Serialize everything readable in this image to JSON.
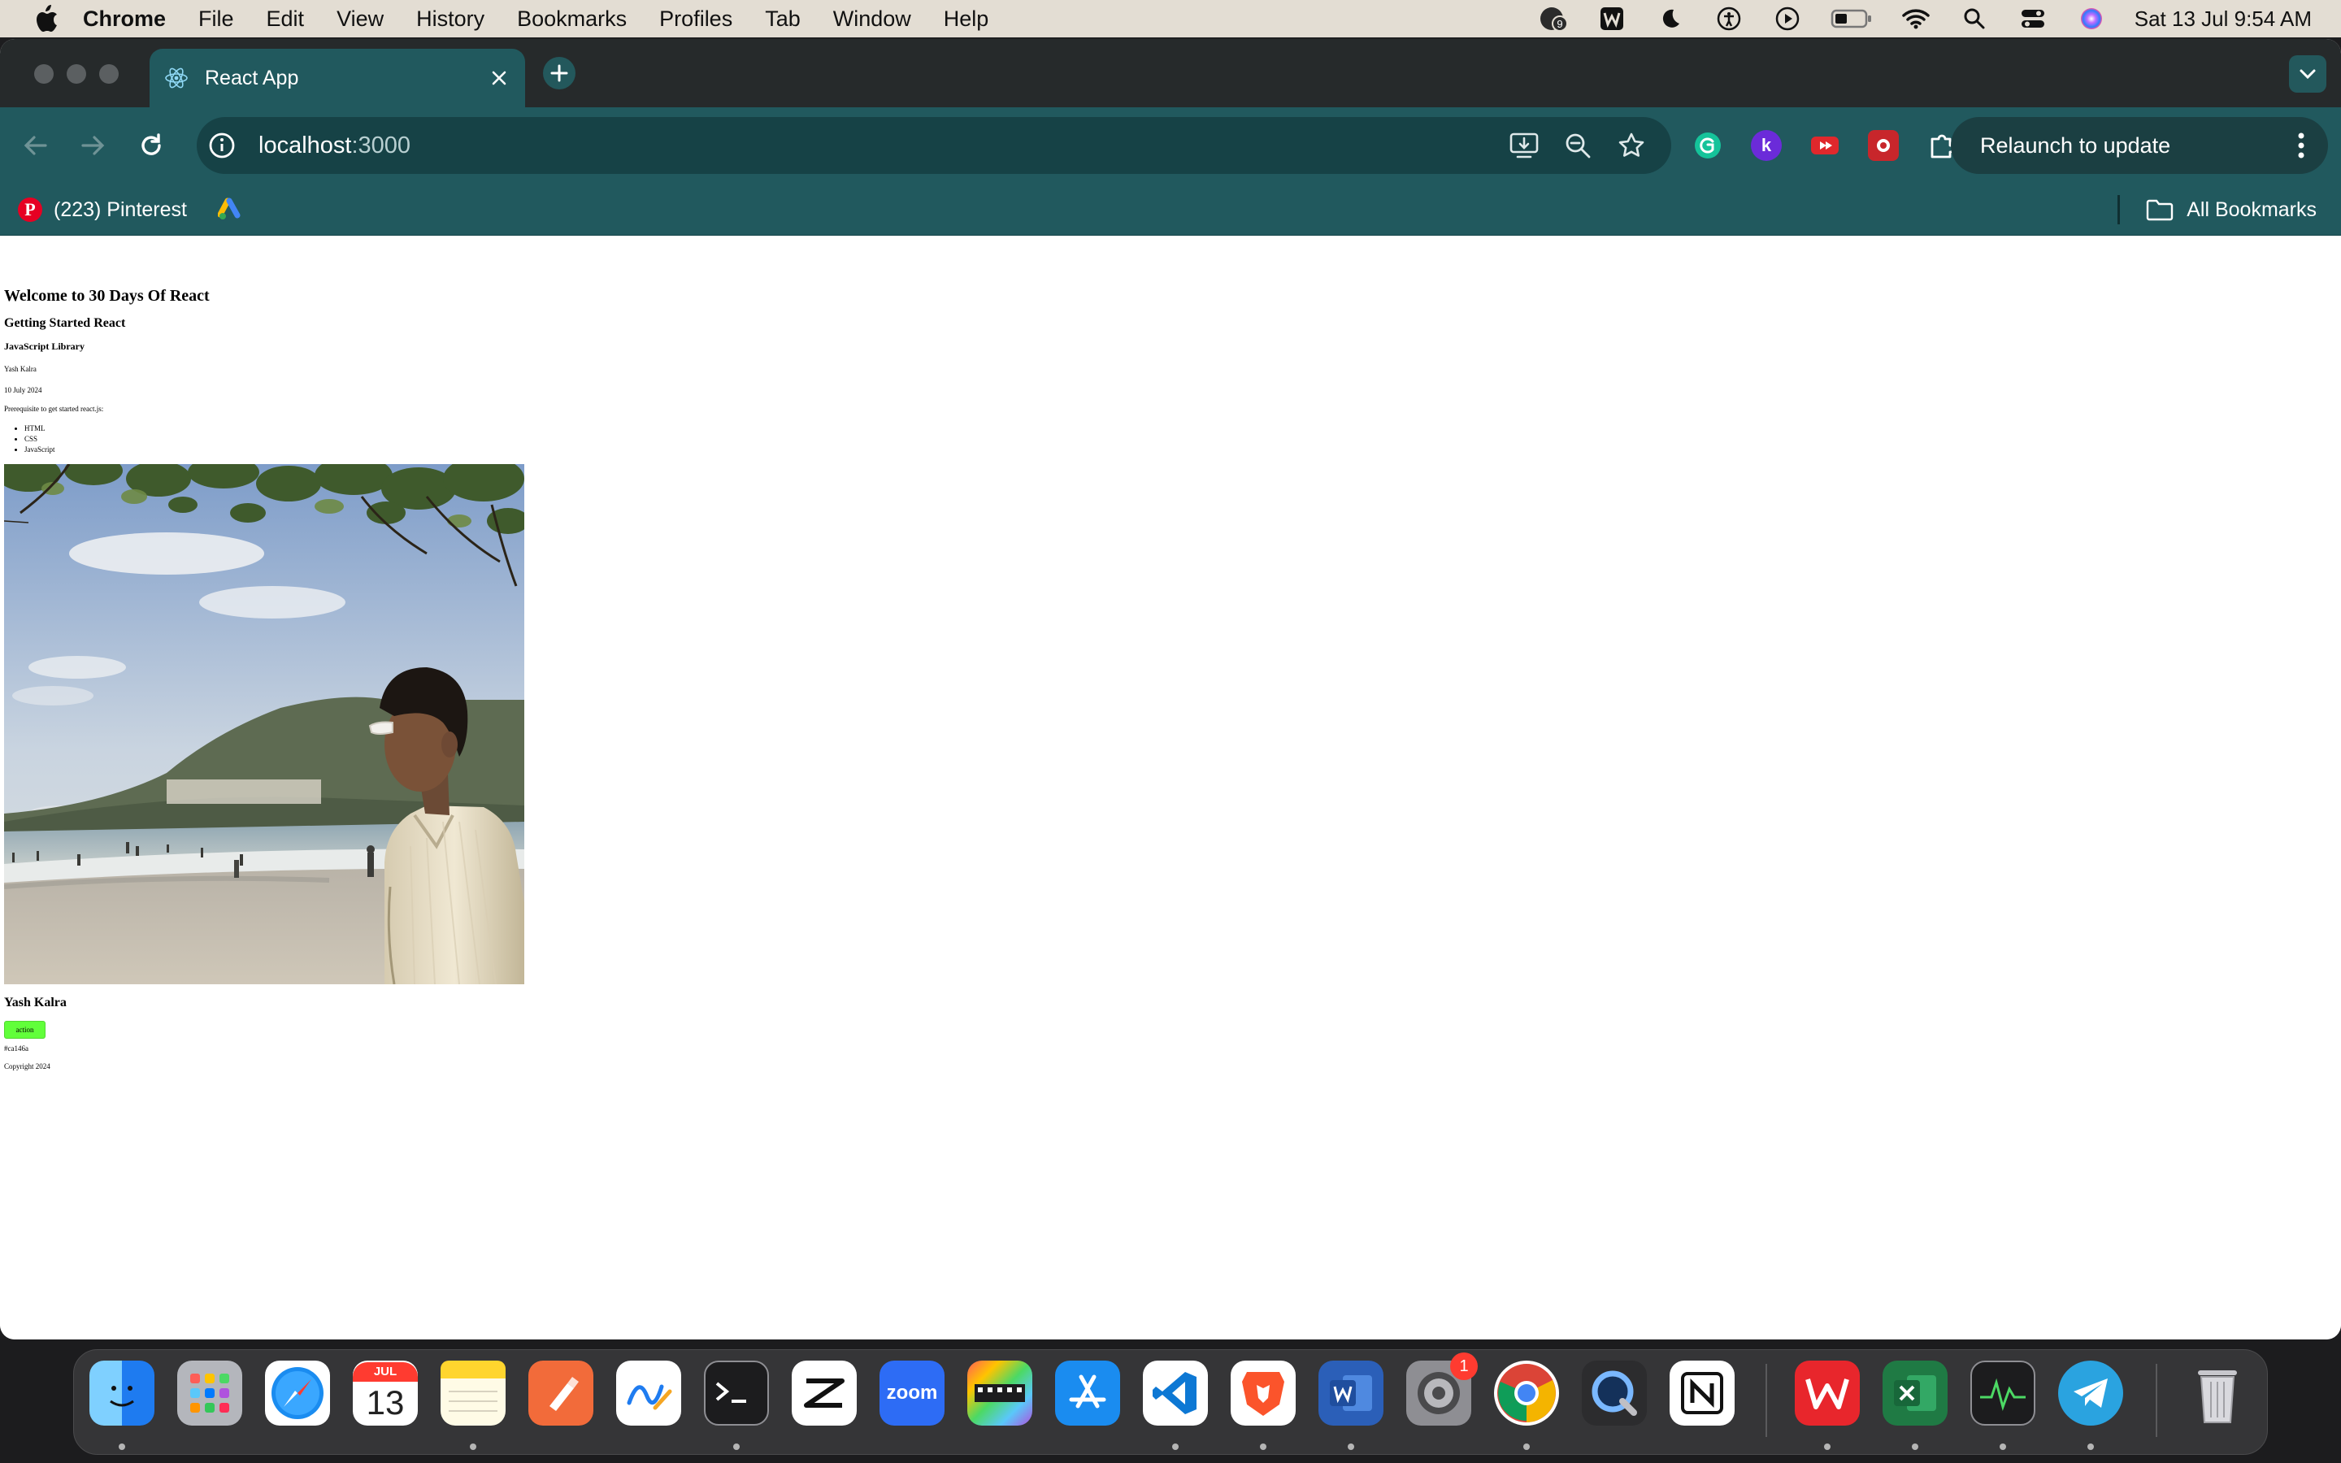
{
  "menubar": {
    "app_name": "Chrome",
    "items": [
      "File",
      "Edit",
      "View",
      "History",
      "Bookmarks",
      "Profiles",
      "Tab",
      "Window",
      "Help"
    ],
    "notification_count": "9",
    "clock": "Sat 13 Jul  9:54 AM"
  },
  "browser": {
    "tab_title": "React App",
    "url_host": "localhost",
    "url_port": ":3000",
    "relaunch_label": "Relaunch to update",
    "bookmarks": {
      "pinterest": "(223) Pinterest",
      "all_bookmarks": "All Bookmarks"
    },
    "extensions": [
      "grammarly-icon",
      "k-extension-icon",
      "youtube-extension-icon",
      "red-extension-icon",
      "puzzle-extensions-icon"
    ]
  },
  "page": {
    "h1": "Welcome to 30 Days Of React",
    "h2": "Getting Started React",
    "h3": "JavaScript Library",
    "author": "Yash Kalra",
    "date": "10 July 2024",
    "prerequisite": "Prerequisite to get started react.js:",
    "tech_list": [
      "HTML",
      "CSS",
      "JavaScript"
    ],
    "profile_name": "Yash Kalra",
    "button_label": "action",
    "color_code": "#ca146a",
    "copyright": "Copyright 2024",
    "button_color": "#61ff3a"
  },
  "dock": {
    "calendar_month": "JUL",
    "calendar_day": "13",
    "zoom_label": "zoom",
    "settings_badge": "1",
    "apps": [
      "finder-icon",
      "launchpad-icon",
      "safari-icon",
      "calendar-icon",
      "notes-icon",
      "pen-app-icon",
      "freeform-icon",
      "terminal-icon",
      "capcut-icon",
      "zoom-icon",
      "final-cut-icon",
      "app-store-icon",
      "vscode-icon",
      "brave-icon",
      "word-icon",
      "system-settings-icon",
      "chrome-icon",
      "quicktime-icon",
      "notion-icon",
      "wps-icon",
      "excel-icon",
      "activity-monitor-icon",
      "telegram-icon",
      "trash-icon"
    ]
  }
}
